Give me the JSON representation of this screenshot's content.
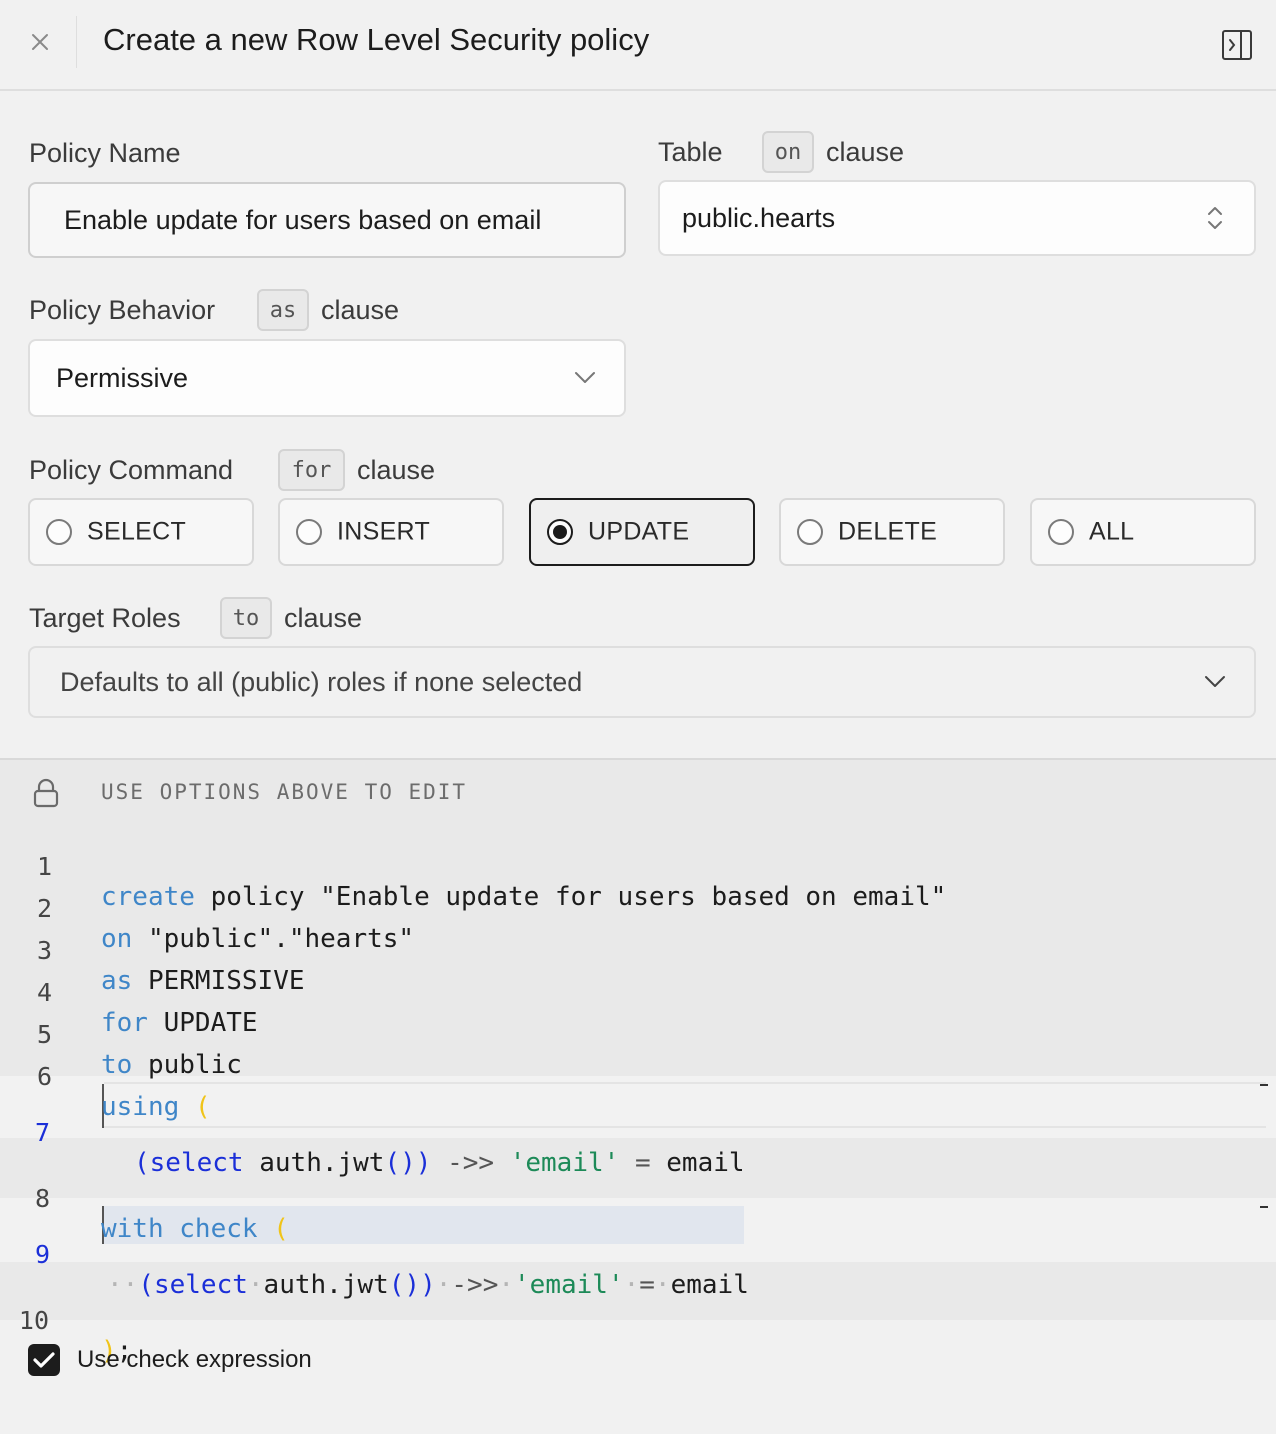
{
  "header": {
    "title": "Create a new Row Level Security policy"
  },
  "policy_name": {
    "label": "Policy Name",
    "value": "Enable update for users based on email"
  },
  "table": {
    "label": "Table",
    "keyword": "on",
    "clause": "clause",
    "value": "public.hearts"
  },
  "behavior": {
    "label": "Policy Behavior",
    "keyword": "as",
    "clause": "clause",
    "value": "Permissive"
  },
  "command": {
    "label": "Policy Command",
    "keyword": "for",
    "clause": "clause",
    "options": [
      "SELECT",
      "INSERT",
      "UPDATE",
      "DELETE",
      "ALL"
    ],
    "selected": "UPDATE"
  },
  "roles": {
    "label": "Target Roles",
    "keyword": "to",
    "clause": "clause",
    "placeholder": "Defaults to all (public) roles if none selected"
  },
  "editor": {
    "hint": "USE OPTIONS ABOVE TO EDIT",
    "line_numbers": [
      "1",
      "2",
      "3",
      "4",
      "5",
      "6",
      "7",
      "8",
      "9",
      "10"
    ],
    "lines": {
      "l1_kw": "create",
      "l1_rest": " policy \"Enable update for users based on email\"",
      "l2_kw": "on",
      "l2_rest": " \"public\".\"hearts\"",
      "l3_kw": "as",
      "l3_rest": " PERMISSIVE",
      "l4_kw": "for",
      "l4_rest": " UPDATE",
      "l5_kw": "to",
      "l5_rest": " public",
      "l6_kw": "using",
      "l6_paren": "(",
      "l7": {
        "open": "(",
        "kw": "select",
        "fn": " auth.jwt",
        "call": "()",
        "close": ")",
        "op": " ->> ",
        "str": "'email'",
        "eq": " = ",
        "col": "email"
      },
      "l8_kw": "with check",
      "l8_paren": "(",
      "l9": {
        "open": "(",
        "kw": "select",
        "fn": "auth.jwt",
        "call": "()",
        "close": ")",
        "op": "->>",
        "str": "'email'",
        "eq": "=",
        "col": "email"
      },
      "l10_paren": ")",
      "l10_semi": ";"
    }
  },
  "check_expression": {
    "label": "Use check expression",
    "checked": true
  }
}
